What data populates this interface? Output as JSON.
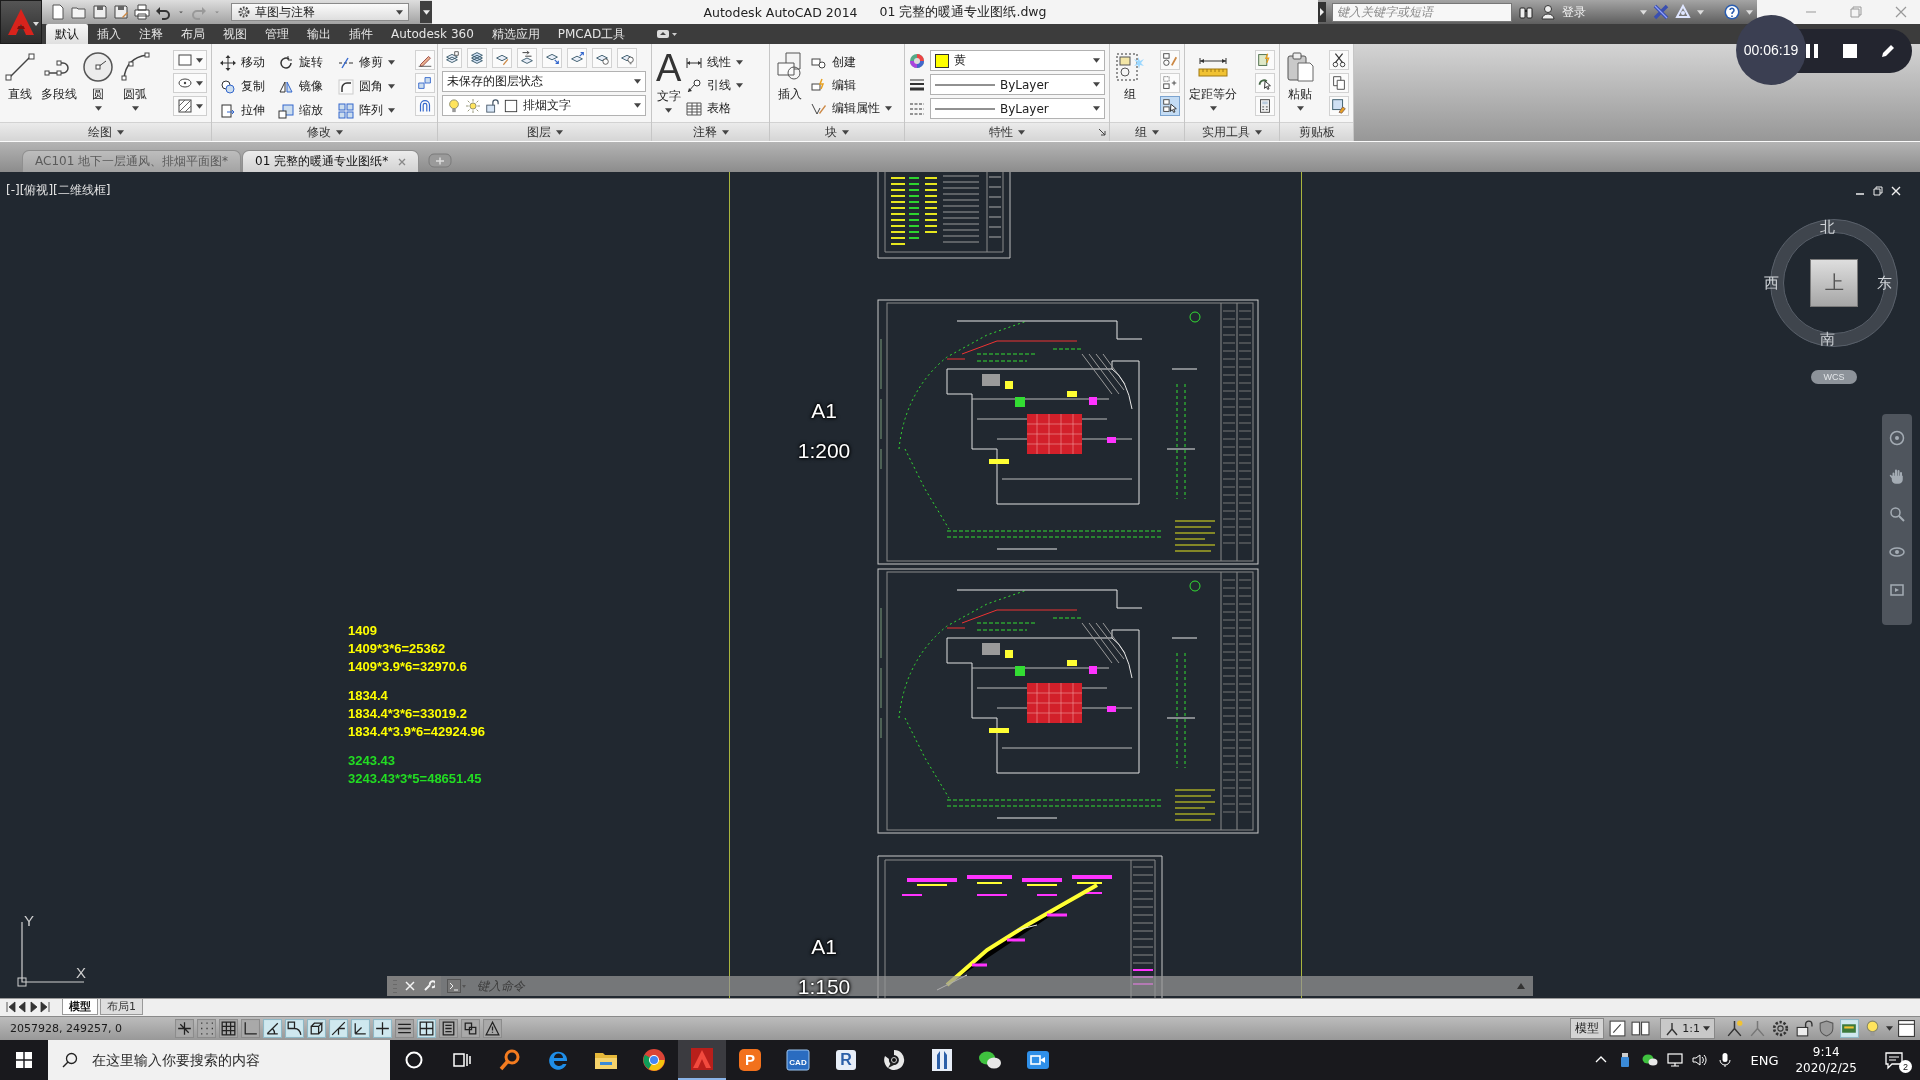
{
  "title_bar": {
    "workspace": "草图与注释",
    "app_title": "Autodesk AutoCAD 2014",
    "document_title": "01 完整的暖通专业图纸.dwg",
    "search_placeholder": "键入关键字或短语",
    "sign_in": "登录"
  },
  "recorder": {
    "time": "00:06:19"
  },
  "ribbon_tabs": [
    {
      "label": "默认",
      "selected": true
    },
    {
      "label": "插入",
      "selected": false
    },
    {
      "label": "注释",
      "selected": false
    },
    {
      "label": "布局",
      "selected": false
    },
    {
      "label": "视图",
      "selected": false
    },
    {
      "label": "管理",
      "selected": false
    },
    {
      "label": "输出",
      "selected": false
    },
    {
      "label": "插件",
      "selected": false
    },
    {
      "label": "Autodesk 360",
      "selected": false
    },
    {
      "label": "精选应用",
      "selected": false
    },
    {
      "label": "PMCAD工具",
      "selected": false
    }
  ],
  "ribbon": {
    "draw": {
      "title": "绘图",
      "buttons": [
        "直线",
        "多段线",
        "圆",
        "圆弧"
      ]
    },
    "modify": {
      "title": "修改",
      "buttons": [
        "移动",
        "旋转",
        "修剪",
        "复制",
        "镜像",
        "圆角",
        "拉伸",
        "缩放",
        "阵列"
      ]
    },
    "layers": {
      "title": "图层",
      "layer_state": "未保存的图层状态",
      "current_layer": "排烟文字"
    },
    "annotation": {
      "title": "注释",
      "text_glyph": "A",
      "text_label": "文字",
      "buttons": [
        "线性",
        "引线",
        "表格"
      ]
    },
    "block": {
      "title": "块",
      "insert": "插入",
      "buttons": [
        "创建",
        "编辑",
        "编辑属性"
      ]
    },
    "properties": {
      "title": "特性",
      "color_label": "黄",
      "lineweight": "ByLayer",
      "linetype": "ByLayer"
    },
    "groups": {
      "title": "组",
      "group": "组"
    },
    "utilities": {
      "title": "实用工具",
      "measure": "定距等分"
    },
    "clipboard": {
      "title": "剪贴板",
      "paste": "粘贴"
    }
  },
  "file_tabs": [
    {
      "label": "AC101 地下一层通风、排烟平面图*",
      "selected": false
    },
    {
      "label": "01 完整的暖通专业图纸*",
      "selected": true
    }
  ],
  "viewport": {
    "label": "[-][俯视][二维线框]"
  },
  "sheet_labels": [
    {
      "size": "A1",
      "scale": "1:200"
    },
    {
      "size": "A1",
      "scale": "1:150"
    }
  ],
  "note_groups": [
    {
      "color": "#ffff00",
      "lines": [
        "1409",
        "1409*3*6=25362",
        "1409*3.9*6=32970.6"
      ]
    },
    {
      "color": "#ffff00",
      "lines": [
        "1834.4",
        "1834.4*3*6=33019.2",
        "1834.4*3.9*6=42924.96"
      ]
    },
    {
      "color": "#22dd22",
      "lines": [
        "3243.43",
        "3243.43*3*5=48651.45"
      ]
    }
  ],
  "viewcube": {
    "north": "北",
    "west": "西",
    "face": "上",
    "east": "东",
    "south": "南",
    "ucs": "WCS"
  },
  "ucs_icon": {
    "y": "Y",
    "x": "X"
  },
  "command_line": {
    "placeholder": "键入命令"
  },
  "layout_tabs": [
    {
      "label": "模型",
      "selected": true
    },
    {
      "label": "布局1",
      "selected": false
    }
  ],
  "status_bar": {
    "coordinates": "2057928, 249257, 0",
    "toggles": [
      {
        "on": false
      },
      {
        "on": false
      },
      {
        "on": false
      },
      {
        "on": false
      },
      {
        "on": true
      },
      {
        "on": true
      },
      {
        "on": true
      },
      {
        "on": true
      },
      {
        "on": true
      },
      {
        "on": true
      },
      {
        "on": false
      },
      {
        "on": true
      },
      {
        "on": false
      },
      {
        "on": false
      },
      {
        "on": false
      }
    ],
    "model": "模型",
    "annotation_scale": "1:1"
  },
  "taskbar": {
    "search_placeholder": "在这里输入你要搜索的内容",
    "apps": [
      {
        "active": false
      },
      {
        "active": false
      },
      {
        "active": false
      },
      {
        "active": false
      },
      {
        "active": true
      },
      {
        "label": "P",
        "active": false
      },
      {
        "label": "CAD",
        "active": false
      },
      {
        "label": "R",
        "active": false
      },
      {
        "active": false
      },
      {
        "active": false
      },
      {
        "active": false
      },
      {
        "active": false
      }
    ],
    "language": "ENG",
    "time": "9:14",
    "date": "2020/2/25",
    "notifications": "2"
  }
}
